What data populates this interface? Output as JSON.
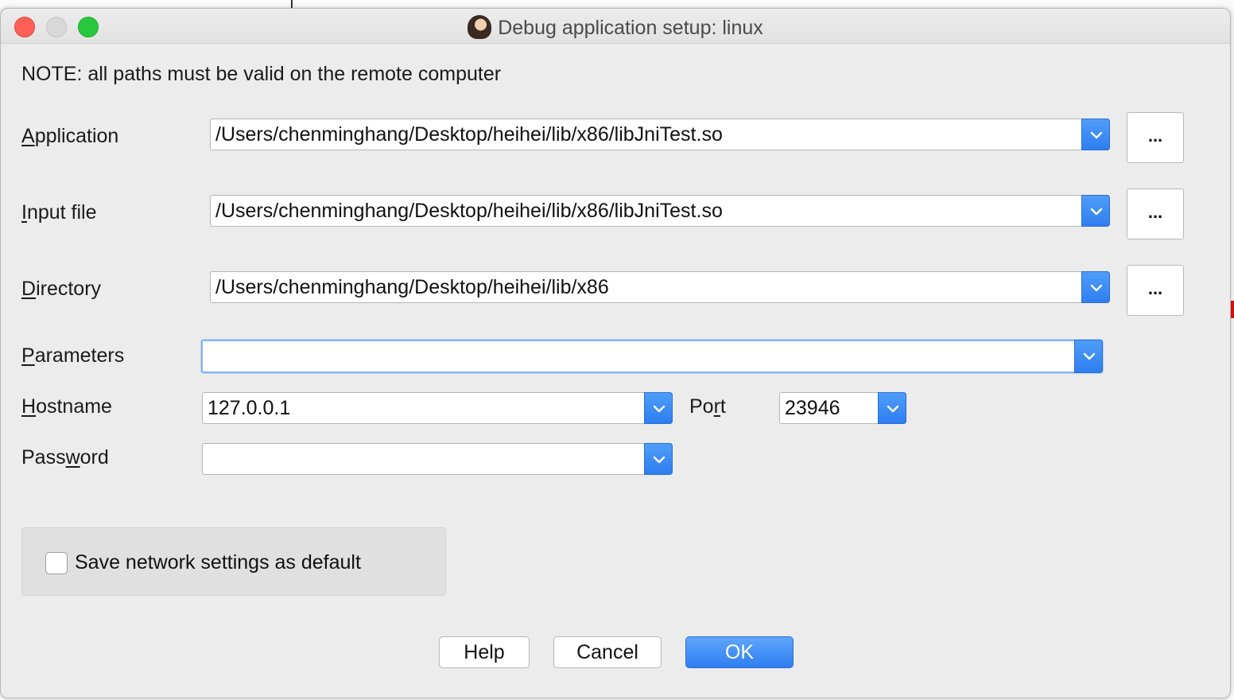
{
  "window": {
    "title": "Debug application setup: linux"
  },
  "note": "NOTE: all paths must be valid on the remote computer",
  "fields": {
    "application": {
      "label_pre": "",
      "label_key": "A",
      "label_post": "pplication",
      "value": "/Users/chenminghang/Desktop/heihei/lib/x86/libJniTest.so",
      "browse": "..."
    },
    "input_file": {
      "label_pre": "",
      "label_key": "I",
      "label_post": "nput file",
      "value": "/Users/chenminghang/Desktop/heihei/lib/x86/libJniTest.so",
      "browse": "..."
    },
    "directory": {
      "label_pre": "",
      "label_key": "D",
      "label_post": "irectory",
      "value": "/Users/chenminghang/Desktop/heihei/lib/x86",
      "browse": "..."
    },
    "parameters": {
      "label_pre": "",
      "label_key": "P",
      "label_post": "arameters",
      "value": ""
    },
    "hostname": {
      "label_pre": "",
      "label_key": "H",
      "label_post": "ostname",
      "value": "127.0.0.1"
    },
    "port": {
      "label_pre": "Po",
      "label_key": "r",
      "label_post": "t",
      "value": "23946"
    },
    "password": {
      "label_pre": "Pass",
      "label_key": "w",
      "label_post": "ord",
      "value": ""
    }
  },
  "save_default": {
    "label": "Save network settings as default",
    "checked": false
  },
  "buttons": {
    "help": "Help",
    "cancel": "Cancel",
    "ok": "OK"
  },
  "colors": {
    "accent": "#2f7ef0",
    "close": "#fe5f57",
    "zoom": "#29c740"
  }
}
